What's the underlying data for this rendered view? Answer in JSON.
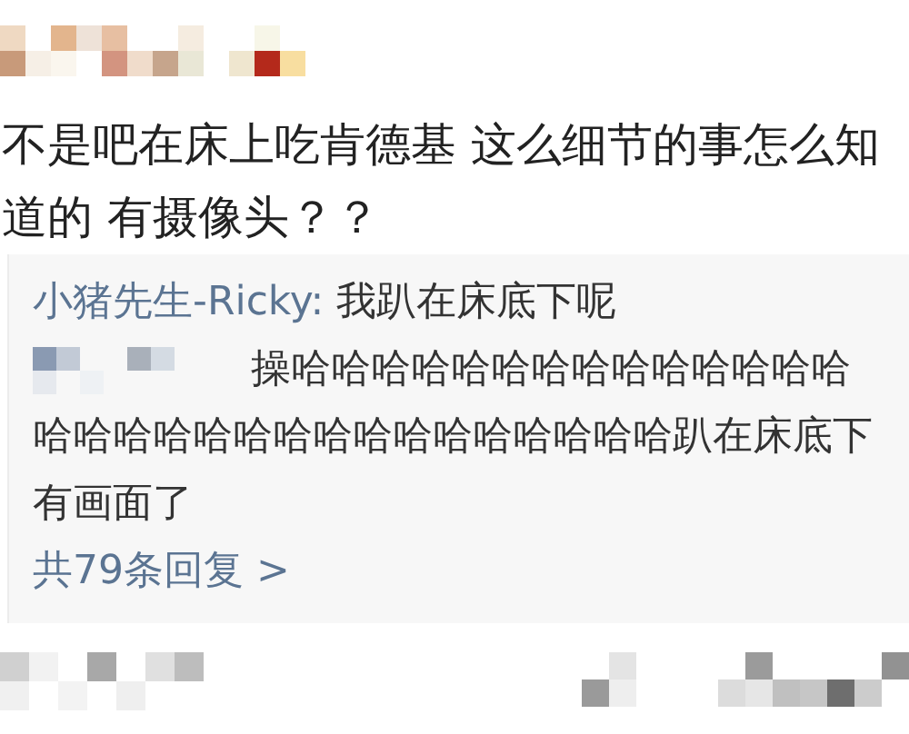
{
  "comment": {
    "text": "不是吧在床上吃肯德基 这么细节的事怎么知道的 有摄像头？？"
  },
  "replies": [
    {
      "kind": "named",
      "author": "小猪先生-Ricky:",
      "lines": [
        "我趴在床底下呢"
      ]
    },
    {
      "kind": "pixelated",
      "lines": [
        "操哈哈哈哈哈哈哈哈哈哈哈哈哈哈",
        "哈哈哈哈哈哈哈哈哈哈哈哈哈哈哈哈趴在床底下",
        "有画面了"
      ]
    }
  ],
  "more_replies": {
    "label": "共79条回复 >"
  }
}
